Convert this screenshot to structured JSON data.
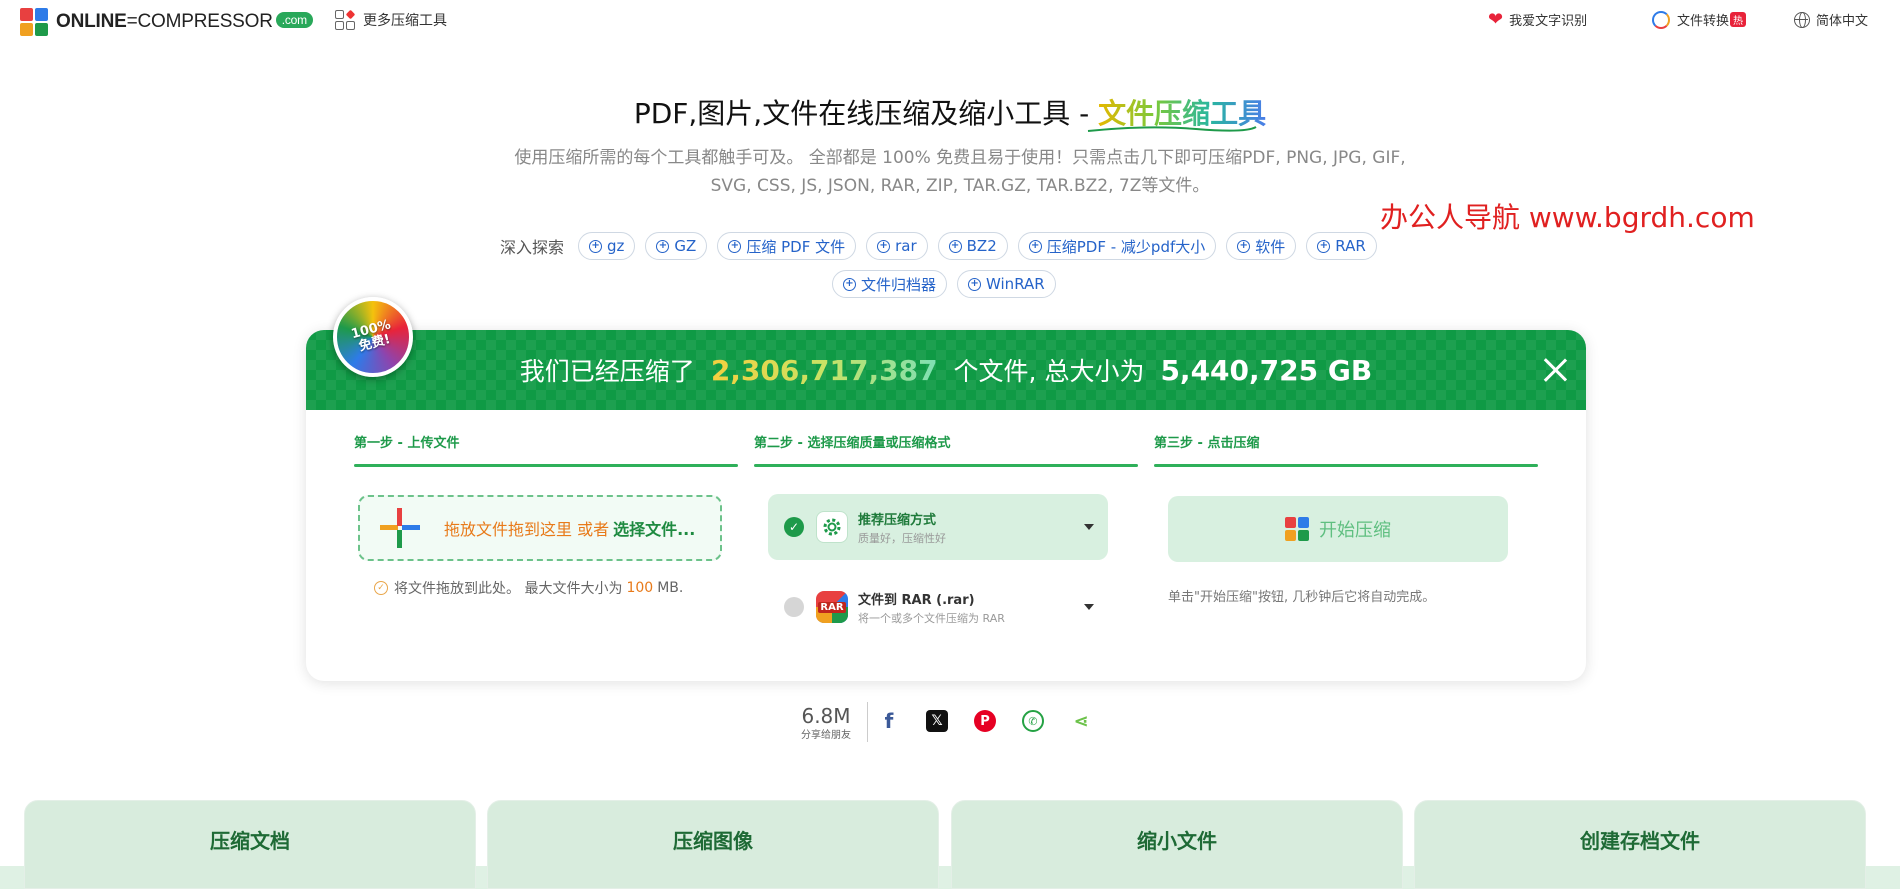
{
  "header": {
    "logo_text": "ONLINE",
    "logo_text_2": "COMPRESSOR",
    "logo_com": ".com",
    "more_tools": "更多压缩工具",
    "ocr_label": "我爱文字识别",
    "convert_label": "文件转换",
    "convert_badge": "热",
    "lang_label": "简体中文"
  },
  "hero": {
    "title_main": "PDF,图片,文件在线压缩及缩小工具 - ",
    "title_accent": "文件压缩工具",
    "desc_line1": "使用压缩所需的每个工具都触手可及。 全部都是 100% 免费且易于使用！只需点击几下即可压缩PDF, PNG, JPG, GIF,",
    "desc_line2": "SVG, CSS, JS, JSON, RAR, ZIP, TAR.GZ, TAR.BZ2, 7Z等文件。"
  },
  "watermark": "办公人导航 www.bgrdh.com",
  "explore": {
    "label": "深入探索",
    "tags": [
      "gz",
      "GZ",
      "压缩 PDF 文件",
      "rar",
      "BZ2",
      "压缩PDF - 减少pdf大小",
      "软件",
      "RAR",
      "文件归档器",
      "WinRAR"
    ]
  },
  "badge": {
    "line1": "100%",
    "line2": "免费!"
  },
  "banner": {
    "prefix": "我们已经压缩了",
    "count": "2,306,717,387",
    "middle": "个文件, 总大小为",
    "size": "5,440,725 GB"
  },
  "steps": {
    "step1": "第一步 - 上传文件",
    "step2": "第二步 - 选择压缩质量或压缩格式",
    "step3": "第三步 - 点击压缩"
  },
  "upload": {
    "drag_text": "拖放文件拖到这里 或者",
    "select_text": "选择文件...",
    "hint_prefix": "将文件拖放到此处。 最大文件大小为",
    "hint_value": "100",
    "hint_unit": "MB."
  },
  "options": [
    {
      "title": "推荐压缩方式",
      "sub": "质量好，压缩性好",
      "selected": true
    },
    {
      "title": "文件到 RAR (.rar)",
      "sub": "将一个或多个文件压缩为 RAR",
      "selected": false,
      "icon_label": "RAR"
    }
  ],
  "start": {
    "button": "开始压缩",
    "hint": "单击\"开始压缩\"按钮, 几秒钟后它将自动完成。"
  },
  "share": {
    "count": "6.8M",
    "label": "分享给朋友"
  },
  "tiles": [
    "压缩文档",
    "压缩图像",
    "缩小文件",
    "创建存档文件"
  ],
  "colors": {
    "brand_green": "#0f9a45",
    "accent_orange": "#e87a1a",
    "link_blue": "#2563c9",
    "watermark_red": "#e02020"
  }
}
